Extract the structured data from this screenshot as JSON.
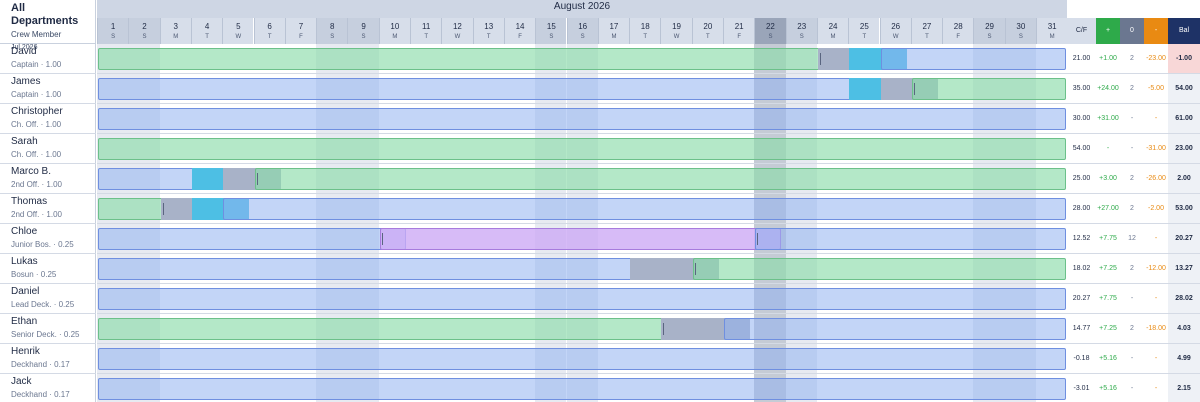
{
  "header": {
    "department": "All Departments",
    "crew_label": "Crew Member",
    "period": "Jul 2026",
    "month_title": "August 2026"
  },
  "days": [
    {
      "n": "1",
      "d": "S"
    },
    {
      "n": "2",
      "d": "S"
    },
    {
      "n": "3",
      "d": "M"
    },
    {
      "n": "4",
      "d": "T"
    },
    {
      "n": "5",
      "d": "W"
    },
    {
      "n": "6",
      "d": "T"
    },
    {
      "n": "7",
      "d": "F"
    },
    {
      "n": "8",
      "d": "S"
    },
    {
      "n": "9",
      "d": "S"
    },
    {
      "n": "10",
      "d": "M"
    },
    {
      "n": "11",
      "d": "T"
    },
    {
      "n": "12",
      "d": "W"
    },
    {
      "n": "13",
      "d": "T"
    },
    {
      "n": "14",
      "d": "F"
    },
    {
      "n": "15",
      "d": "S"
    },
    {
      "n": "16",
      "d": "S"
    },
    {
      "n": "17",
      "d": "M"
    },
    {
      "n": "18",
      "d": "T"
    },
    {
      "n": "19",
      "d": "W"
    },
    {
      "n": "20",
      "d": "T"
    },
    {
      "n": "21",
      "d": "F"
    },
    {
      "n": "22",
      "d": "S"
    },
    {
      "n": "23",
      "d": "S"
    },
    {
      "n": "24",
      "d": "M"
    },
    {
      "n": "25",
      "d": "T"
    },
    {
      "n": "26",
      "d": "W"
    },
    {
      "n": "27",
      "d": "T"
    },
    {
      "n": "28",
      "d": "F"
    },
    {
      "n": "29",
      "d": "S"
    },
    {
      "n": "30",
      "d": "S"
    },
    {
      "n": "31",
      "d": "M"
    }
  ],
  "today_day": 22,
  "summary_headers": [
    "C/F",
    "+",
    "0",
    "-",
    "Bal"
  ],
  "colors": {
    "blue": "#92b2f0",
    "green": "#8cdcaa",
    "purple": "#cdaaf5",
    "grey": "#a8b2c8",
    "cyan": "#4dbfe4",
    "plus": "#2eaa4a",
    "zero": "#6b7790",
    "minus": "#e98a12",
    "bal": "#1e3266",
    "alert": "#f8d7d7"
  },
  "crew": [
    {
      "name": "David",
      "role": "Captain · 1.00",
      "segments": [
        {
          "t": "green",
          "s": 1,
          "e": 23.9
        },
        {
          "t": "grey",
          "s": 24,
          "e": 24.9
        },
        {
          "t": "cyan",
          "s": 25,
          "e": 25.9
        },
        {
          "t": "blue",
          "s": 26,
          "e": 31
        }
      ],
      "ticks": [
        24
      ],
      "summary": {
        "cf": "21.00",
        "plus": "+1.00",
        "zero": "2",
        "minus": "-23.00",
        "bal": "-1.00",
        "alert": true
      }
    },
    {
      "name": "James",
      "role": "Captain · 1.00",
      "segments": [
        {
          "t": "blue",
          "s": 1,
          "e": 24.9
        },
        {
          "t": "cyan",
          "s": 25,
          "e": 25.9
        },
        {
          "t": "grey",
          "s": 26,
          "e": 26.9
        },
        {
          "t": "green",
          "s": 27,
          "e": 31
        }
      ],
      "ticks": [
        27
      ],
      "summary": {
        "cf": "35.00",
        "plus": "+24.00",
        "zero": "2",
        "minus": "-5.00",
        "bal": "54.00",
        "alert": false
      }
    },
    {
      "name": "Christopher",
      "role": "Ch. Off. · 1.00",
      "segments": [
        {
          "t": "blue",
          "s": 1,
          "e": 31
        }
      ],
      "ticks": [],
      "summary": {
        "cf": "30.00",
        "plus": "+31.00",
        "zero": "-",
        "minus": "-",
        "bal": "61.00",
        "alert": false
      }
    },
    {
      "name": "Sarah",
      "role": "Ch. Off. · 1.00",
      "segments": [
        {
          "t": "green",
          "s": 1,
          "e": 31
        }
      ],
      "ticks": [],
      "summary": {
        "cf": "54.00",
        "plus": "-",
        "zero": "-",
        "minus": "-31.00",
        "bal": "23.00",
        "alert": false
      }
    },
    {
      "name": "Marco B.",
      "role": "2nd Off. · 1.00",
      "segments": [
        {
          "t": "blue",
          "s": 1,
          "e": 3.9
        },
        {
          "t": "cyan",
          "s": 4,
          "e": 4.9
        },
        {
          "t": "grey",
          "s": 5,
          "e": 5.9
        },
        {
          "t": "green",
          "s": 6,
          "e": 31
        }
      ],
      "ticks": [
        6
      ],
      "summary": {
        "cf": "25.00",
        "plus": "+3.00",
        "zero": "2",
        "minus": "-26.00",
        "bal": "2.00",
        "alert": false
      }
    },
    {
      "name": "Thomas",
      "role": "2nd Off. · 1.00",
      "segments": [
        {
          "t": "green",
          "s": 1,
          "e": 2.9
        },
        {
          "t": "grey",
          "s": 3,
          "e": 3.9
        },
        {
          "t": "cyan",
          "s": 4,
          "e": 4.9
        },
        {
          "t": "blue",
          "s": 5,
          "e": 31
        }
      ],
      "ticks": [
        3
      ],
      "summary": {
        "cf": "28.00",
        "plus": "+27.00",
        "zero": "2",
        "minus": "-2.00",
        "bal": "53.00",
        "alert": false
      }
    },
    {
      "name": "Chloe",
      "role": "Junior Bos. · 0.25",
      "segments": [
        {
          "t": "blue",
          "s": 1,
          "e": 9.9
        },
        {
          "t": "purple",
          "s": 10,
          "e": 21.9
        },
        {
          "t": "blue",
          "s": 22,
          "e": 31
        }
      ],
      "ticks": [
        10,
        22
      ],
      "summary": {
        "cf": "12.52",
        "plus": "+7.75",
        "zero": "12",
        "minus": "-",
        "bal": "20.27",
        "alert": false
      }
    },
    {
      "name": "Lukas",
      "role": "Bosun · 0.25",
      "segments": [
        {
          "t": "blue",
          "s": 1,
          "e": 17.9
        },
        {
          "t": "grey",
          "s": 18,
          "e": 19.9
        },
        {
          "t": "green",
          "s": 20,
          "e": 31
        }
      ],
      "ticks": [
        20
      ],
      "summary": {
        "cf": "18.02",
        "plus": "+7.25",
        "zero": "2",
        "minus": "-12.00",
        "bal": "13.27",
        "alert": false
      }
    },
    {
      "name": "Daniel",
      "role": "Lead Deck. · 0.25",
      "segments": [
        {
          "t": "blue",
          "s": 1,
          "e": 31
        }
      ],
      "ticks": [],
      "summary": {
        "cf": "20.27",
        "plus": "+7.75",
        "zero": "-",
        "minus": "-",
        "bal": "28.02",
        "alert": false
      }
    },
    {
      "name": "Ethan",
      "role": "Senior Deck. · 0.25",
      "segments": [
        {
          "t": "green",
          "s": 1,
          "e": 18.9
        },
        {
          "t": "grey",
          "s": 19,
          "e": 20.9
        },
        {
          "t": "blue",
          "s": 21,
          "e": 31
        }
      ],
      "ticks": [
        19
      ],
      "summary": {
        "cf": "14.77",
        "plus": "+7.25",
        "zero": "2",
        "minus": "-18.00",
        "bal": "4.03",
        "alert": false
      }
    },
    {
      "name": "Henrik",
      "role": "Deckhand · 0.17",
      "segments": [
        {
          "t": "blue",
          "s": 1,
          "e": 31
        }
      ],
      "ticks": [],
      "summary": {
        "cf": "-0.18",
        "plus": "+5.16",
        "zero": "-",
        "minus": "-",
        "bal": "4.99",
        "alert": false
      }
    },
    {
      "name": "Jack",
      "role": "Deckhand · 0.17",
      "segments": [
        {
          "t": "blue",
          "s": 1,
          "e": 31
        }
      ],
      "ticks": [],
      "summary": {
        "cf": "-3.01",
        "plus": "+5.16",
        "zero": "-",
        "minus": "-",
        "bal": "2.15",
        "alert": false
      }
    }
  ]
}
